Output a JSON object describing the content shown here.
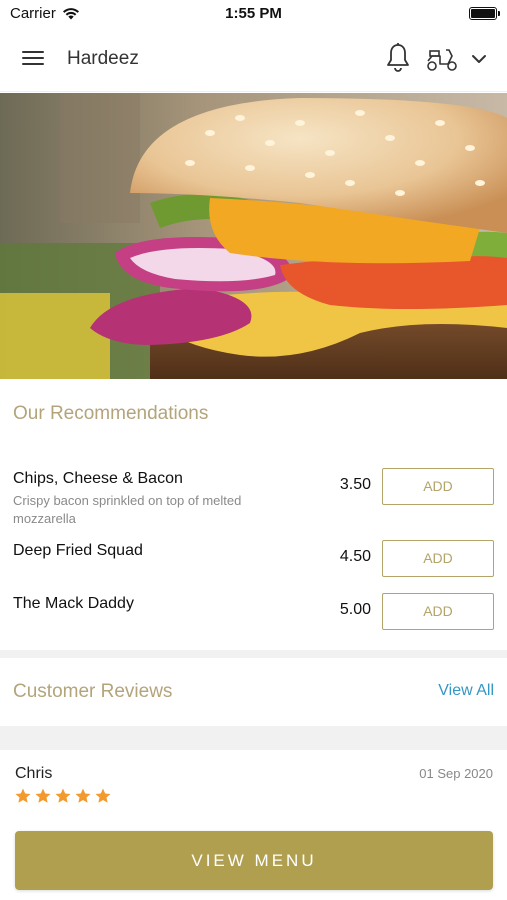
{
  "status_bar": {
    "carrier": "Carrier",
    "time": "1:55 PM",
    "icons": [
      "wifi-icon",
      "battery-icon"
    ]
  },
  "header": {
    "title": "Hardeez",
    "icons": [
      "hamburger-menu-icon",
      "bell-icon",
      "scooter-icon",
      "chevron-down-icon"
    ]
  },
  "hero": {
    "image": "burger photo"
  },
  "recommendations": {
    "title": "Our Recommendations",
    "items": [
      {
        "name": "Chips, Cheese & Bacon",
        "description": "Crispy bacon sprinkled on top of melted mozzarella",
        "price": "3.50",
        "button": "ADD"
      },
      {
        "name": "Deep Fried Squad",
        "description": "",
        "price": "4.50",
        "button": "ADD"
      },
      {
        "name": "The Mack Daddy",
        "description": "",
        "price": "5.00",
        "button": "ADD"
      }
    ]
  },
  "reviews": {
    "title": "Customer Reviews",
    "view_all": "View All",
    "items": [
      {
        "name": "Chris",
        "date": "01 Sep 2020",
        "rating": 5
      }
    ]
  },
  "footer": {
    "view_menu": "VIEW MENU"
  },
  "colors": {
    "accent_gold": "#b09f4f",
    "section_title": "#b3a47b",
    "link_blue": "#3597c4",
    "star_orange": "#f29a2e"
  }
}
